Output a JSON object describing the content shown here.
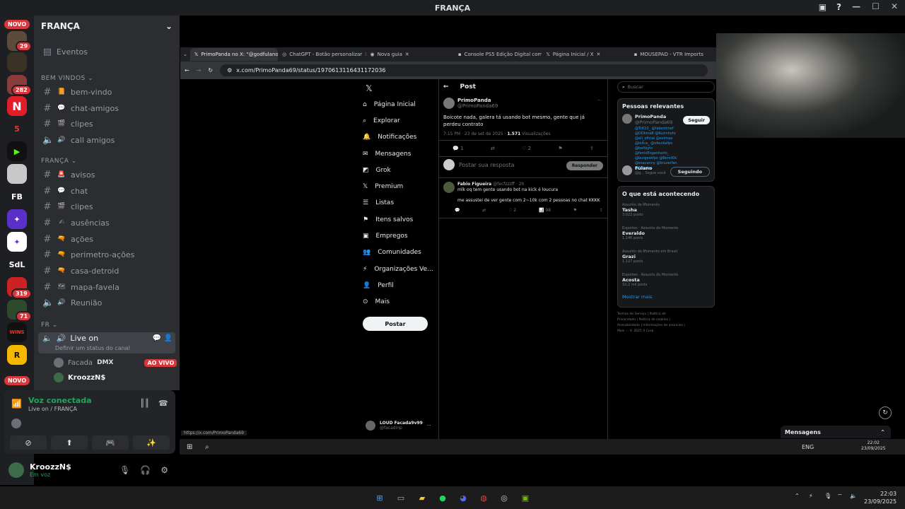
{
  "window": {
    "title": "FRANÇA"
  },
  "servers": {
    "top_badge": "29",
    "badge_282": "282",
    "badge_319": "319",
    "badge_71": "71",
    "novo_top": "NOVO",
    "novo_bottom": "NOVO",
    "fb": "FB",
    "sdl": "SdL"
  },
  "guild": {
    "name": "FRANÇA",
    "eventos": "Eventos",
    "cat_bemvindos": "BEM VINDOS",
    "cat_franca": "FRANÇA",
    "cat_fr": "FR",
    "channels_a": [
      {
        "label": "bem-vindo",
        "emoji": "📙",
        "type": "text"
      },
      {
        "label": "chat-amigos",
        "emoji": "💬",
        "type": "text"
      },
      {
        "label": "clipes",
        "emoji": "🎬",
        "type": "text"
      },
      {
        "label": "call amigos",
        "emoji": "🔊",
        "type": "voice"
      }
    ],
    "channels_b": [
      {
        "label": "avisos",
        "emoji": "🚨",
        "type": "text"
      },
      {
        "label": "chat",
        "emoji": "💬",
        "type": "text"
      },
      {
        "label": "clipes",
        "emoji": "🎬",
        "type": "text"
      },
      {
        "label": "ausências",
        "emoji": "✍",
        "type": "text"
      },
      {
        "label": "ações",
        "emoji": "🔫",
        "type": "text"
      },
      {
        "label": "perimetro-ações",
        "emoji": "🔫",
        "type": "text"
      },
      {
        "label": "casa-detroid",
        "emoji": "🔫",
        "type": "text"
      },
      {
        "label": "mapa-favela",
        "emoji": "🗺",
        "type": "text"
      },
      {
        "label": "Reunião",
        "emoji": "🔊",
        "type": "voice"
      }
    ],
    "live_channel": "Live on",
    "live_status": "Definir um status do canal",
    "voice_users": [
      {
        "name": "Facada",
        "tag": "DMX",
        "live": "AO VIVO"
      },
      {
        "name": "KroozzN$"
      }
    ]
  },
  "voice_panel": {
    "status": "Voz conectada",
    "location": "Live on / FRANÇA"
  },
  "user": {
    "name": "KroozzN$",
    "status": "Em voz"
  },
  "browser": {
    "tabs": [
      "PrimoPanda no X: \"@godfulano",
      "ChatGPT - Botão personalizar",
      "Nova guia",
      "Console PS5 Edição Digital com",
      "Página Inicial / X",
      "MOUSEPAD - VTR Imports"
    ],
    "url": "x.com/PrimoPanda69/status/1970613116431172036",
    "status_url": "https://x.com/PrimoPanda69"
  },
  "x": {
    "nav": [
      "Página Inicial",
      "Explorar",
      "Notificações",
      "Mensagens",
      "Grok",
      "Premium",
      "Listas",
      "Itens salvos",
      "Empregos",
      "Comunidades",
      "Organizações Ve...",
      "Perfil",
      "Mais"
    ],
    "postar": "Postar",
    "header": "Post",
    "post": {
      "author": "PrimoPanda",
      "handle": "@PrimoPanda69",
      "text": "Boicote nada, galera tá usando bot mesmo, gente que já perdeu contrato",
      "meta": "7:15 PM · 23 de set de 2025 ·",
      "views": "1.571",
      "views_label": "Visualizações",
      "likes": "2",
      "replies": "1"
    },
    "reply_placeholder": "Postar sua resposta",
    "reply_button": "Responder",
    "reply": {
      "author": "Fabio Figueira",
      "handle": "@fecfzzzff · 2h",
      "line1": "mlk oq tem gente usando bot na kick é loucura",
      "line2": "me assustei de ver gente com 2~10k com 2 pessoas no chat KKKK",
      "views": "98",
      "likes": "2"
    },
    "account": {
      "name": "LOUD Facada9v99",
      "handle": "@facadinp"
    },
    "search_placeholder": "Buscar",
    "relevant_title": "Pessoas relevantes",
    "relevant": {
      "name": "PrimoPanda",
      "handle": "@PrimoPanda69",
      "follow": "Seguir",
      "bio": "@TcK10_ @fakeshinef @DDkinaB @Kuzinhotv @ell_oficial @eximaa @lolica_ @ofeuikafps @beltkytv @fenixEngenheiro_ @burgeskfps @Bersil0k @esacanny @bruzerfan @Funzim",
      "name2": "Fulano",
      "handle2": "@g...",
      "follow2": "Seguindo",
      "segue": "Segue você"
    },
    "trends_title": "O que está acontecendo",
    "trends": [
      {
        "context": "Assunto do Momento",
        "name": "Tasha",
        "count": "3.022 posts"
      },
      {
        "context": "Esportes · Assunto do Momento",
        "name": "Everaldo",
        "count": "1.146 posts"
      },
      {
        "context": "Assunto do Momento em Brasil",
        "name": "Grazi",
        "count": "1.127 posts"
      },
      {
        "context": "Esportes · Assunto do Momento",
        "name": "Acosta",
        "count": "10,2 mil posts"
      }
    ],
    "show_more": "Mostrar mais",
    "footer": "Termos de Serviço | Política de Privacidade | Política de cookies | Acessibilidade | Informações de anúncios | Mais ··· © 2025 X Corp.",
    "messages": "Mensagens"
  },
  "stream_clock": {
    "time": "22:02",
    "date": "23/09/2025",
    "lang": "ENG"
  },
  "os_clock": {
    "time": "22:03",
    "date": "23/09/2025"
  }
}
